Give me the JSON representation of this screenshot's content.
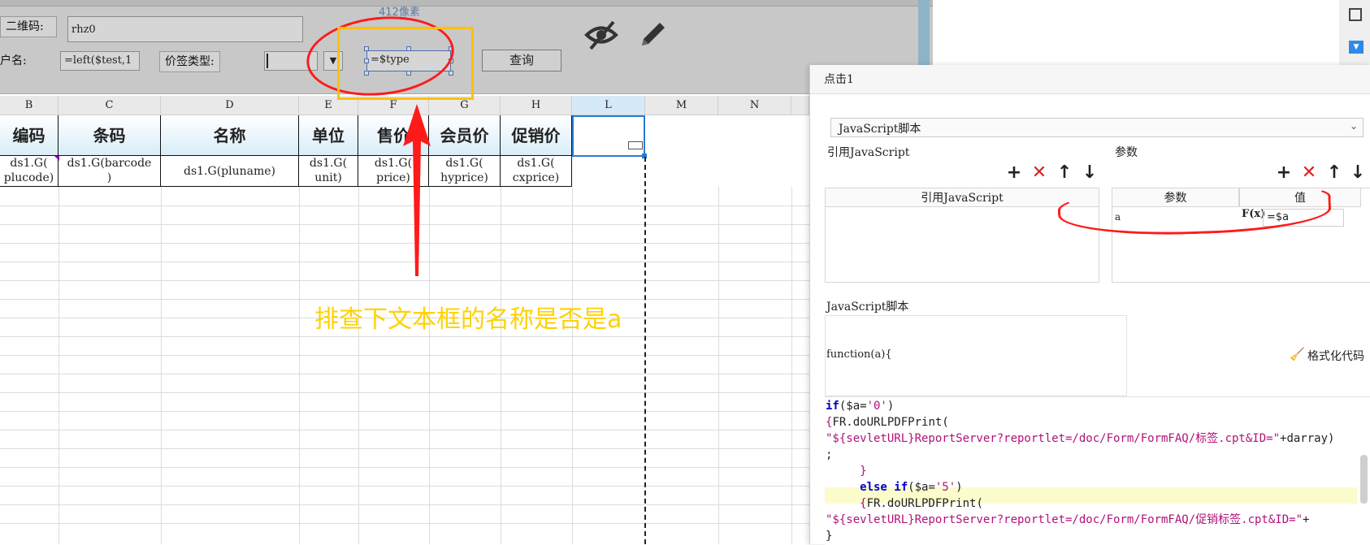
{
  "ruler_text": "412像素",
  "params": {
    "qr_label": "二维码:",
    "qr_value": "rhz0",
    "name_label": "户名:",
    "name_value": "=left($test,1",
    "price_type_label": "价签类型:",
    "type_value": "=$type",
    "query_button": "查询",
    "icon_hide": "eye-slash-icon",
    "icon_edit": "pencil-icon"
  },
  "sheet": {
    "columns": [
      "B",
      "C",
      "D",
      "E",
      "F",
      "G",
      "H",
      "L",
      "M",
      "N"
    ],
    "header_row": [
      "编码",
      "条码",
      "名称",
      "单位",
      "售价",
      "会员价",
      "促销价"
    ],
    "data_row": [
      "ds1.G(\nplucode)",
      "ds1.G(barcode\n)",
      "ds1.G(pluname)",
      "ds1.G(\nunit)",
      "ds1.G(\nprice)",
      "ds1.G(\nhyprice)",
      "ds1.G(\ncxprice)"
    ]
  },
  "annotation_text": "排查下文本框的名称是否是a",
  "dialog": {
    "title": "点击1",
    "type_select": "JavaScript脚本",
    "ref_js_label": "引用JavaScript",
    "params_label": "参数",
    "ref_js_header": "引用JavaScript",
    "params_header": "参数",
    "value_header": "值",
    "param_name": "a",
    "fx_label": "F(x)",
    "param_value": "=$a",
    "script_label": "JavaScript脚本",
    "function_sig": "function(a){",
    "format_button": "格式化代码",
    "tool_add": "+",
    "tool_delete": "✕",
    "tool_up": "↑",
    "tool_down": "↓",
    "code": {
      "line1_kw": "if",
      "line1_rest": "($a=",
      "line1_str": "'0'",
      "line1_end": ")",
      "line2_brace": "{",
      "line2_fn": "FR.doURLPDFPrint(",
      "line3_str": "\"${sevletURL}ReportServer?reportlet=/doc/Form/FormFAQ/标签.cpt&ID=\"",
      "line3_end": "+darray)",
      "line4": ";",
      "line5": "     }",
      "line6_kw": "     else if",
      "line6_rest": "($a=",
      "line6_str": "'5'",
      "line6_end": ")",
      "line7_brace": "     {",
      "line7_fn": "FR.doURLPDFPrint(",
      "line8_str": "\"${sevletURL}ReportServer?reportlet=/doc/Form/FormFAQ/促销标签.cpt&ID=\"",
      "line8_end": "+",
      "line9": "}"
    }
  },
  "colors": {
    "annotation_red": "#ff1a1a",
    "annotation_yellow": "#ffc000",
    "header_gradient": "#d9edf9",
    "selected_cell": "#2a7ad5"
  }
}
